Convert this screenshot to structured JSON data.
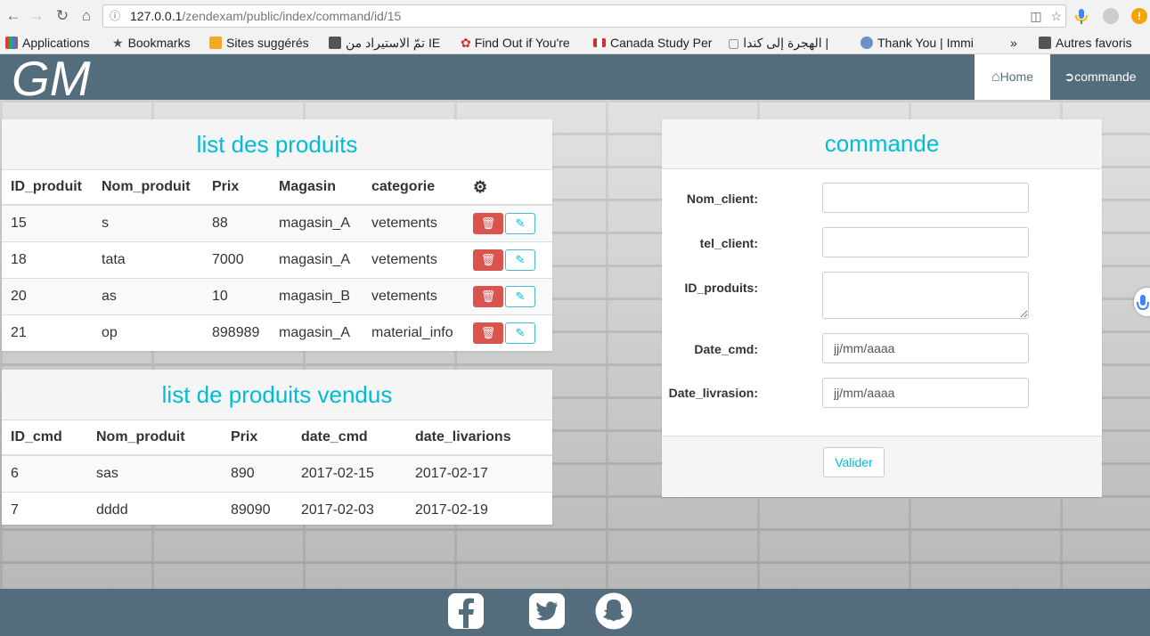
{
  "browser": {
    "url_host": "127.0.0.1",
    "url_path": "/zendexam/public/index/command/id/15",
    "bookmarks": [
      {
        "label": "Applications"
      },
      {
        "label": "Bookmarks"
      },
      {
        "label": "Sites suggérés"
      },
      {
        "label": "تمّ الاستيراد من IE"
      },
      {
        "label": "Find Out if You're"
      },
      {
        "label": "Canada Study Per"
      },
      {
        "label": "الهجرة إلى كندا |"
      },
      {
        "label": "Thank You | Immi"
      },
      {
        "label": "»"
      },
      {
        "label": "Autres favoris"
      }
    ]
  },
  "navbar": {
    "brand": "GM",
    "home": "Home",
    "commande": "commande"
  },
  "produits": {
    "title": "list des produits",
    "columns": [
      "ID_produit",
      "Nom_produit",
      "Prix",
      "Magasin",
      "categorie"
    ],
    "rows": [
      {
        "id": "15",
        "nom": "s",
        "prix": "88",
        "magasin": "magasin_A",
        "categorie": "vetements"
      },
      {
        "id": "18",
        "nom": "tata",
        "prix": "7000",
        "magasin": "magasin_A",
        "categorie": "vetements"
      },
      {
        "id": "20",
        "nom": "as",
        "prix": "10",
        "magasin": "magasin_B",
        "categorie": "vetements"
      },
      {
        "id": "21",
        "nom": "op",
        "prix": "898989",
        "magasin": "magasin_A",
        "categorie": "material_info"
      }
    ]
  },
  "vendus": {
    "title": "list de produits vendus",
    "columns": [
      "ID_cmd",
      "Nom_produit",
      "Prix",
      "date_cmd",
      "date_livarions"
    ],
    "rows": [
      {
        "id": "6",
        "nom": "sas",
        "prix": "890",
        "date_cmd": "2017-02-15",
        "date_liv": "2017-02-17"
      },
      {
        "id": "7",
        "nom": "dddd",
        "prix": "89090",
        "date_cmd": "2017-02-03",
        "date_liv": "2017-02-19"
      }
    ]
  },
  "commande": {
    "title": "commande",
    "fields": {
      "nom_client": {
        "label": "Nom_client:",
        "value": ""
      },
      "tel_client": {
        "label": "tel_client:",
        "value": ""
      },
      "id_produits": {
        "label": "ID_produits:",
        "value": ""
      },
      "date_cmd": {
        "label": "Date_cmd:",
        "placeholder": "jj/mm/aaaa"
      },
      "date_livrasion": {
        "label": "Date_livrasion:",
        "placeholder": "jj/mm/aaaa"
      }
    },
    "submit": "Valider"
  },
  "colors": {
    "navbar": "#546d7c",
    "accent": "#00bcd4",
    "danger": "#d9534f"
  },
  "icons": [
    "back-icon",
    "forward-icon",
    "reload-icon",
    "home-icon",
    "info-icon",
    "translate-icon",
    "star-icon",
    "mic-icon",
    "gear-icon",
    "trash-icon",
    "edit-icon",
    "login-icon",
    "facebook-icon",
    "twitter-icon",
    "snapchat-icon"
  ]
}
